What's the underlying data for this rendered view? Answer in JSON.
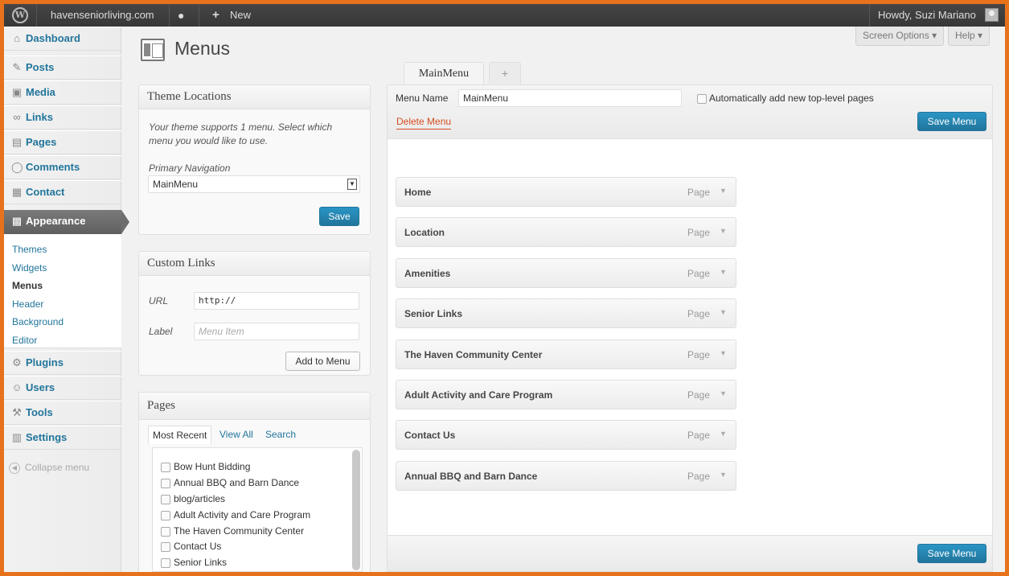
{
  "adminbar": {
    "site_name": "havenseniorliving.com",
    "new_label": "New",
    "greeting": "Howdy, Suzi Mariano",
    "icons": [
      "wordpress-logo",
      "comment-bubble",
      "plus",
      "avatar"
    ]
  },
  "sidebar": {
    "items": [
      {
        "label": "Dashboard",
        "icon": "⌂"
      },
      {
        "label": "Posts",
        "icon": "✎"
      },
      {
        "label": "Media",
        "icon": "▣"
      },
      {
        "label": "Links",
        "icon": "∞"
      },
      {
        "label": "Pages",
        "icon": "▤"
      },
      {
        "label": "Comments",
        "icon": "◯"
      },
      {
        "label": "Contact",
        "icon": "▦"
      },
      {
        "label": "Appearance",
        "icon": "▩"
      },
      {
        "label": "Plugins",
        "icon": "⚙"
      },
      {
        "label": "Users",
        "icon": "☺"
      },
      {
        "label": "Tools",
        "icon": "⚒"
      },
      {
        "label": "Settings",
        "icon": "▥"
      }
    ],
    "submenu": [
      "Themes",
      "Widgets",
      "Menus",
      "Header",
      "Background",
      "Editor"
    ],
    "collapse_label": "Collapse menu"
  },
  "screen_options": {
    "screen_options_label": "Screen Options",
    "help_label": "Help"
  },
  "page": {
    "title": "Menus"
  },
  "theme_locations": {
    "heading": "Theme Locations",
    "description": "Your theme supports 1 menu. Select which menu you would like to use.",
    "primary_label": "Primary Navigation",
    "selected": "MainMenu",
    "save_label": "Save"
  },
  "custom_links": {
    "heading": "Custom Links",
    "url_label": "URL",
    "url_value": "http://",
    "label_label": "Label",
    "label_placeholder": "Menu Item",
    "add_label": "Add to Menu"
  },
  "pages_box": {
    "heading": "Pages",
    "tabs": [
      "Most Recent",
      "View All",
      "Search"
    ],
    "items": [
      "Bow Hunt Bidding",
      "Annual BBQ and Barn Dance",
      "blog/articles",
      "Adult Activity and Care Program",
      "The Haven Community Center",
      "Contact Us",
      "Senior Links"
    ]
  },
  "editor": {
    "tab_active": "MainMenu",
    "tab_add": "+",
    "menu_name_label": "Menu Name",
    "menu_name_value": "MainMenu",
    "auto_add_label": "Automatically add new top-level pages",
    "delete_label": "Delete Menu",
    "save_label": "Save Menu",
    "items": [
      {
        "title": "Home",
        "type": "Page"
      },
      {
        "title": "Location",
        "type": "Page"
      },
      {
        "title": "Amenities",
        "type": "Page"
      },
      {
        "title": "Senior Links",
        "type": "Page"
      },
      {
        "title": "The Haven Community Center",
        "type": "Page"
      },
      {
        "title": "Adult Activity and Care Program",
        "type": "Page"
      },
      {
        "title": "Contact Us",
        "type": "Page"
      },
      {
        "title": "Annual BBQ and Barn Dance",
        "type": "Page"
      }
    ]
  },
  "colors": {
    "link": "#21759b",
    "primary_button": "#21759b",
    "frame_border": "#e8711c",
    "delete": "#d54e21"
  }
}
